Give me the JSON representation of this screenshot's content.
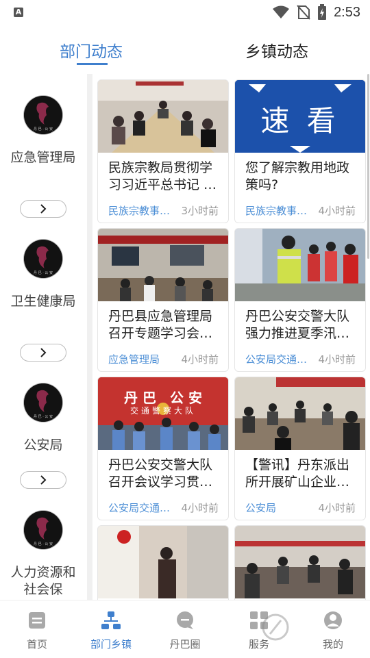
{
  "status_bar": {
    "time": "2:53",
    "left_icon_letter": "A"
  },
  "top_tabs": [
    {
      "label": "部门动态",
      "active": true
    },
    {
      "label": "乡镇动态",
      "active": false
    }
  ],
  "sidebar": {
    "items": [
      {
        "label": "应急管理局"
      },
      {
        "label": "卫生健康局"
      },
      {
        "label": "公安局"
      },
      {
        "label": "人力资源和社会保"
      }
    ]
  },
  "cards": [
    {
      "title": "民族宗教局贯彻学习习近平总书记 …",
      "source": "民族宗教事…",
      "time": "3小时前"
    },
    {
      "title": "您了解宗教用地政策吗?",
      "source": "民族宗教事…",
      "time": "4小时前",
      "banner_text": "速 看"
    },
    {
      "title": "丹巴县应急管理局召开专题学习会…",
      "source": "应急管理局",
      "time": "4小时前"
    },
    {
      "title": "丹巴公安交警大队强力推进夏季汛…",
      "source": "公安局交通…",
      "time": "4小时前"
    },
    {
      "title": "丹巴公安交警大队召开会议学习贯…",
      "source": "公安局交通…",
      "time": "4小时前",
      "banner_text": "丹 巴　公 安",
      "banner_sub": "交通警察大队"
    },
    {
      "title": "【警讯】丹东派出所开展矿山企业…",
      "source": "公安局",
      "time": "4小时前"
    },
    {
      "title": "",
      "source": "",
      "time": ""
    },
    {
      "title": "",
      "source": "",
      "time": ""
    }
  ],
  "bottom_nav": [
    {
      "label": "首页",
      "icon": "home-doc-icon",
      "active": false
    },
    {
      "label": "部门乡镇",
      "icon": "org-chart-icon",
      "active": true
    },
    {
      "label": "丹巴圈",
      "icon": "chat-bubble-icon",
      "active": false
    },
    {
      "label": "服务",
      "icon": "grid-apps-icon",
      "active": false
    },
    {
      "label": "我的",
      "icon": "user-icon",
      "active": false
    }
  ],
  "colors": {
    "accent": "#3f7fcd",
    "source_blue": "#4d8fd6",
    "time_gray": "#999999"
  }
}
